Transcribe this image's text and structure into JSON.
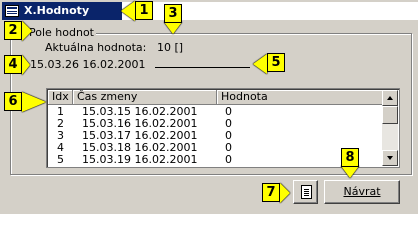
{
  "window": {
    "title": "X.Hodnoty"
  },
  "callouts": [
    "1",
    "2",
    "3",
    "4",
    "5",
    "6",
    "7",
    "8"
  ],
  "group": {
    "label": "Pole hodnot"
  },
  "current": {
    "label": "Aktuálna hodnota:",
    "value": "10 []"
  },
  "timestamp": {
    "value": "15.03.26 16.02.2001"
  },
  "list": {
    "headers": [
      "Idx",
      "Čas zmeny",
      "Hodnota"
    ],
    "rows": [
      [
        "1",
        "15.03.15 16.02.2001",
        "0"
      ],
      [
        "2",
        "15.03.16 16.02.2001",
        "0"
      ],
      [
        "3",
        "15.03.17 16.02.2001",
        "0"
      ],
      [
        "4",
        "15.03.18 16.02.2001",
        "0"
      ],
      [
        "5",
        "15.03.19 16.02.2001",
        "0"
      ]
    ]
  },
  "buttons": {
    "details_icon": "document-icon",
    "back_label": "Návrat"
  }
}
